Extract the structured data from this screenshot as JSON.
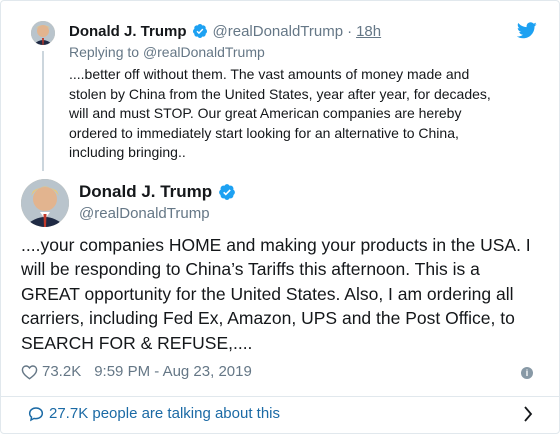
{
  "parent_tweet": {
    "display_name": "Donald J. Trump",
    "handle": "@realDonaldTrump",
    "separator": "·",
    "time": "18h",
    "replying_prefix": "Replying to ",
    "replying_handle": "@realDonaldTrump",
    "lines": [
      "....better off without them. The vast amounts of money made and",
      "stolen by China from the United States, year after year, for decades,",
      "will and must STOP. Our great American companies are hereby",
      "ordered to immediately start looking for an alternative to China,",
      "including bringing.."
    ]
  },
  "main_tweet": {
    "display_name": "Donald J. Trump",
    "handle": "@realDonaldTrump",
    "lines": [
      "....your companies HOME and making your products in the USA. I",
      "will be responding to China’s Tariffs this afternoon. This is a",
      "GREAT opportunity for the United States. Also, I am ordering all",
      "carriers, including Fed Ex, Amazon, UPS and the Post Office, to",
      "SEARCH FOR & REFUSE,...."
    ],
    "likes": "73.2K",
    "timestamp": "9:59 PM - Aug 23, 2019",
    "info_glyph": "i"
  },
  "conversation": {
    "count": "27.7K",
    "label": "people are talking about this"
  },
  "icons": {
    "verified": "verified-badge-icon",
    "brand": "twitter-bird-icon",
    "like": "heart-icon",
    "info": "info-icon",
    "replies": "speech-bubble-icon",
    "open": "chevron-right-icon"
  },
  "colors": {
    "twitter_blue": "#1da1f2",
    "link_blue": "#1b6aa5",
    "secondary_text": "#657786",
    "primary_text": "#14171a",
    "border": "#e1e8ed"
  }
}
